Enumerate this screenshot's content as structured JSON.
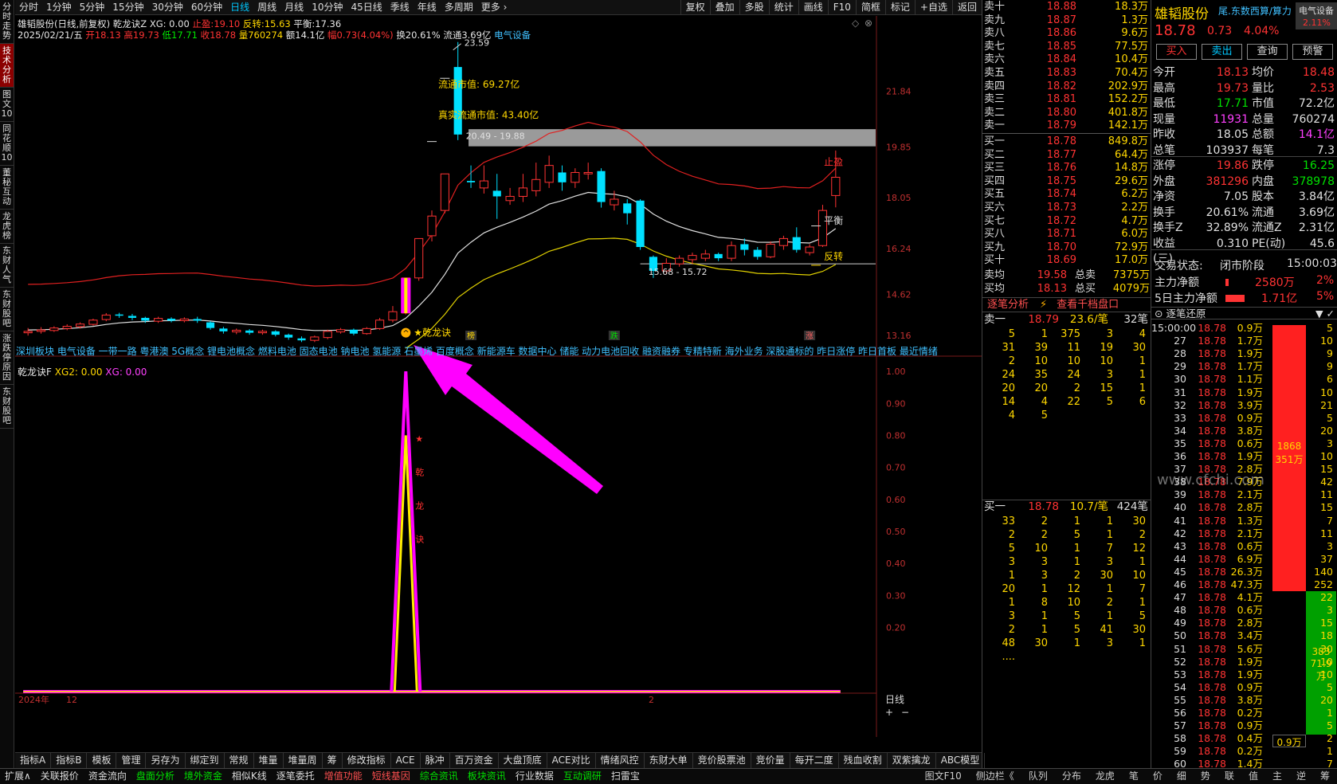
{
  "left_tabs": [
    "分时走势",
    "技术分析",
    "图文10",
    "同花顺10",
    "董秘互动",
    "龙虎榜",
    "东财人气",
    "东财股吧",
    "涨跌停原因",
    "东财股吧"
  ],
  "period_tabs": [
    "分时",
    "1分钟",
    "5分钟",
    "15分钟",
    "30分钟",
    "60分钟",
    "日线",
    "周线",
    "月线",
    "10分钟",
    "45日线",
    "季线",
    "年线",
    "多周期",
    "更多"
  ],
  "top_actions": [
    "复权",
    "叠加",
    "多股",
    "统计",
    "画线",
    "F10",
    "简框",
    "标记",
    "+自选",
    "返回"
  ],
  "info": {
    "name": "雄韬股份(日线,前复权)",
    "indicator": "乾龙诀Z",
    "xg": "XG: 0.00",
    "stop_label": "止盈:",
    "stop": "19.10",
    "reverse_label": "反转:",
    "reverse": "15.63",
    "balance_label": "平衡:",
    "balance": "17.36"
  },
  "ohlc": {
    "date": "2025/02/21/五",
    "open_l": "开",
    "open": "18.13",
    "high_l": "高",
    "high": "19.73",
    "low_l": "低",
    "low": "17.71",
    "close_l": "收",
    "close": "18.78",
    "vol_l": "量",
    "vol": "760274",
    "amt": "额14.1亿",
    "chg": "幅0.73(4.04%)",
    "turn": "换20.61%",
    "float": "流通3.69亿",
    "sector": "电气设备"
  },
  "chart_labels": {
    "peak": "23.59",
    "float_mv": "流通市值: 69.27亿",
    "real_float_mv": "真实流通市值: 43.40亿",
    "range1": "20.49 - 19.88",
    "range2": "15.68 - 15.72",
    "stop_tag": "止盈",
    "balance_tag": "平衡",
    "reverse_tag": "反转",
    "signal": "★乾龙诀",
    "marker_bang": "榜",
    "marker_die": "跌",
    "marker_zhang": "涨"
  },
  "price_axis": [
    "21.84",
    "19.85",
    "18.05",
    "16.24",
    "14.62",
    "13.16"
  ],
  "sub_axis": [
    "1.00",
    "0.90",
    "0.80",
    "0.70",
    "0.60",
    "0.50",
    "0.40",
    "0.30",
    "0.20"
  ],
  "sectors": "深圳板块 电气设备 一带一路 粤港澳 5G概念 锂电池概念 燃料电池 固态电池 钠电池 氢能源 石墨烯 百度概念 新能源车 数据中心 储能 动力电池回收 融资融券 专精特新 海外业务 深股通标的 昨日涨停 昨日首板 最近情绪",
  "sub_head": {
    "name": "乾龙诀F",
    "xg2": "XG2: 0.00",
    "xg": "XG: 0.00",
    "label": "★ 乾 龙 诀"
  },
  "x_axis": [
    "2024年",
    "12",
    "2"
  ],
  "bottom_tabs": [
    "指标A",
    "指标B",
    "模板",
    "管理",
    "另存为",
    "绑定到",
    "常规",
    "堆量",
    "堆量周",
    "筹",
    "修改指标",
    "ACE",
    "脉冲",
    "百万资金",
    "大盘顶底",
    "ACE对比",
    "情绪风控",
    "东财大单",
    "竞价股票池",
    "竞价量",
    "每开二度",
    "残血收割",
    "双紫擒龙",
    "ABC模型"
  ],
  "status_bar": [
    "扩展∧",
    "关联报价",
    "资金流向",
    "盘面分析",
    "境外资金",
    "相似K线",
    "逐笔委托",
    "增值功能",
    "短线基因",
    "综合资讯",
    "板块资讯",
    "行业数据",
    "互动调研",
    "扫雷宝"
  ],
  "status_right": [
    "图文F10",
    "侧边栏《",
    "队列",
    "分布",
    "龙虎",
    "笔",
    "价",
    "细",
    "势",
    "联",
    "值",
    "主",
    "逆",
    "筹"
  ],
  "period_right": "日线",
  "sells": [
    [
      "卖十",
      "18.88",
      "18.3万"
    ],
    [
      "卖九",
      "18.87",
      "1.3万"
    ],
    [
      "卖八",
      "18.86",
      "9.6万"
    ],
    [
      "卖七",
      "18.85",
      "77.5万"
    ],
    [
      "卖六",
      "18.84",
      "10.4万"
    ],
    [
      "卖五",
      "18.83",
      "70.4万"
    ],
    [
      "卖四",
      "18.82",
      "202.9万"
    ],
    [
      "卖三",
      "18.81",
      "152.2万"
    ],
    [
      "卖二",
      "18.80",
      "401.8万"
    ],
    [
      "卖一",
      "18.79",
      "142.1万"
    ]
  ],
  "buys": [
    [
      "买一",
      "18.78",
      "849.8万"
    ],
    [
      "买二",
      "18.77",
      "64.4万"
    ],
    [
      "买三",
      "18.76",
      "14.8万"
    ],
    [
      "买四",
      "18.75",
      "29.6万"
    ],
    [
      "买五",
      "18.74",
      "6.2万"
    ],
    [
      "买六",
      "18.73",
      "2.2万"
    ],
    [
      "买七",
      "18.72",
      "4.7万"
    ],
    [
      "买八",
      "18.71",
      "6.0万"
    ],
    [
      "买九",
      "18.70",
      "72.9万"
    ],
    [
      "买十",
      "18.69",
      "17.0万"
    ]
  ],
  "avg": [
    [
      "卖均",
      "19.58",
      "总卖",
      "7375万"
    ],
    [
      "买均",
      "18.13",
      "总买",
      "4079万"
    ]
  ],
  "tick_tabs": [
    "逐笔分析",
    "查看千档盘口"
  ],
  "sell1": {
    "label": "卖一",
    "price": "18.79",
    "per": "23.6/笔",
    "cnt": "32笔"
  },
  "sell_queue": [
    [
      "5",
      "1",
      "375",
      "3",
      "4"
    ],
    [
      "31",
      "39",
      "11",
      "19",
      "30"
    ],
    [
      "2",
      "10",
      "10",
      "10",
      "1"
    ],
    [
      "24",
      "35",
      "24",
      "3",
      "1"
    ],
    [
      "20",
      "20",
      "2",
      "15",
      "1"
    ],
    [
      "14",
      "4",
      "22",
      "5",
      "6"
    ],
    [
      "4",
      "5",
      "",
      "",
      ""
    ]
  ],
  "buy1": {
    "label": "买一",
    "price": "18.78",
    "per": "10.7/笔",
    "cnt": "424笔"
  },
  "buy_queue": [
    [
      "33",
      "2",
      "1",
      "1",
      "30"
    ],
    [
      "2",
      "2",
      "5",
      "1",
      "2"
    ],
    [
      "5",
      "10",
      "1",
      "7",
      "12"
    ],
    [
      "3",
      "3",
      "1",
      "3",
      "1"
    ],
    [
      "1",
      "3",
      "2",
      "30",
      "10"
    ],
    [
      "20",
      "1",
      "12",
      "1",
      "7"
    ],
    [
      "1",
      "8",
      "10",
      "2",
      "1"
    ],
    [
      "3",
      "1",
      "5",
      "1",
      "5"
    ],
    [
      "2",
      "1",
      "5",
      "41",
      "30"
    ],
    [
      "48",
      "30",
      "1",
      "3",
      "1"
    ],
    [
      "....",
      "",
      "",
      "",
      ""
    ]
  ],
  "quote": {
    "name": "雄韬股份",
    "tag": "尾.东数西算/算力",
    "sector_badge": "电气设备",
    "sector_pct": "2.11%",
    "price": "18.78",
    "chg": "0.73",
    "pct": "4.04%"
  },
  "quote_buttons": [
    "买入",
    "卖出",
    "查询",
    "预警"
  ],
  "quote_rows": [
    [
      "今开",
      "18.13",
      "均价",
      "18.48"
    ],
    [
      "最高",
      "19.73",
      "量比",
      "2.53"
    ],
    [
      "最低",
      "17.71",
      "市值",
      "72.2亿"
    ],
    [
      "现量",
      "11931",
      "总量",
      "760274"
    ],
    [
      "昨收",
      "18.05",
      "总额",
      "14.1亿"
    ],
    [
      "总笔",
      "103937",
      "每笔",
      "7.3"
    ],
    [
      "涨停",
      "19.86",
      "跌停",
      "16.25"
    ],
    [
      "外盘",
      "381296",
      "内盘",
      "378978"
    ],
    [
      "净资",
      "7.05",
      "股本",
      "3.84亿"
    ],
    [
      "换手",
      "20.61%",
      "流通",
      "3.69亿"
    ],
    [
      "换手Z",
      "32.89%",
      "流通Z",
      "2.31亿"
    ],
    [
      "收益(三)",
      "0.310",
      "PE(动)",
      "45.6"
    ]
  ],
  "trade_status": {
    "label": "交易状态:",
    "value": "闭市阶段",
    "time": "15:00:03"
  },
  "main_net": {
    "label": "主力净额",
    "value": "2580万",
    "pct": "2%"
  },
  "main_net5": {
    "label": "5日主力净额",
    "value": "1.71亿",
    "pct": "5%"
  },
  "trade_title": "逐笔还原",
  "trades": [
    [
      "15:00:00",
      "18.78",
      "0.9万",
      "5"
    ],
    [
      "27",
      "18.78",
      "1.7万",
      "10"
    ],
    [
      "28",
      "18.78",
      "1.9万",
      "9"
    ],
    [
      "29",
      "18.78",
      "1.7万",
      "9"
    ],
    [
      "30",
      "18.78",
      "1.1万",
      "6"
    ],
    [
      "31",
      "18.78",
      "1.9万",
      "10"
    ],
    [
      "32",
      "18.78",
      "3.9万",
      "21"
    ],
    [
      "33",
      "18.78",
      "0.9万",
      "5"
    ],
    [
      "34",
      "18.78",
      "3.8万",
      "20"
    ],
    [
      "35",
      "18.78",
      "0.6万",
      "3"
    ],
    [
      "36",
      "18.78",
      "1.9万",
      "10"
    ],
    [
      "37",
      "18.78",
      "2.8万",
      "15"
    ],
    [
      "38",
      "18.78",
      "7.9万",
      "42"
    ],
    [
      "39",
      "18.78",
      "2.1万",
      "11"
    ],
    [
      "40",
      "18.78",
      "2.8万",
      "15"
    ],
    [
      "41",
      "18.78",
      "1.3万",
      "7"
    ],
    [
      "42",
      "18.78",
      "2.1万",
      "11"
    ],
    [
      "43",
      "18.78",
      "0.6万",
      "3"
    ],
    [
      "44",
      "18.78",
      "6.9万",
      "37"
    ],
    [
      "45",
      "18.78",
      "26.3万",
      "140"
    ],
    [
      "46",
      "18.78",
      "47.3万",
      "252"
    ],
    [
      "47",
      "18.78",
      "4.1万",
      "22"
    ],
    [
      "48",
      "18.78",
      "0.6万",
      "3"
    ],
    [
      "49",
      "18.78",
      "2.8万",
      "15"
    ],
    [
      "50",
      "18.78",
      "3.4万",
      "18"
    ],
    [
      "51",
      "18.78",
      "5.6万",
      "30"
    ],
    [
      "52",
      "18.78",
      "1.9万",
      "10"
    ],
    [
      "53",
      "18.78",
      "1.9万",
      "10"
    ],
    [
      "54",
      "18.78",
      "0.9万",
      "5"
    ],
    [
      "55",
      "18.78",
      "3.8万",
      "20"
    ],
    [
      "56",
      "18.78",
      "0.2万",
      "1"
    ],
    [
      "57",
      "18.78",
      "0.9万",
      "5"
    ],
    [
      "58",
      "18.78",
      "0.4万",
      "2"
    ],
    [
      "59",
      "18.78",
      "0.2万",
      "1"
    ],
    [
      "60",
      "18.78",
      "1.4万",
      "7"
    ]
  ],
  "bar1": {
    "n": "1868",
    "v": "351万"
  },
  "bar2": {
    "n": "383",
    "v": "71.9万"
  },
  "bar3": {
    "v": "0.9万"
  },
  "watermark": "www.cfchi.com",
  "colors": {
    "up": "#ff3333",
    "down": "#00e0ff",
    "ma_red": "#e02020",
    "ma_white": "#e0e0e0",
    "ma_yellow": "#e0d000",
    "signal": "#ff00ff"
  },
  "candles": [
    {
      "o": 13.25,
      "c": 13.3,
      "h": 13.42,
      "l": 13.15
    },
    {
      "o": 13.3,
      "c": 13.35,
      "h": 13.45,
      "l": 13.22
    },
    {
      "o": 13.33,
      "c": 13.42,
      "h": 13.48,
      "l": 13.28
    },
    {
      "o": 13.4,
      "c": 13.48,
      "h": 13.55,
      "l": 13.34
    },
    {
      "o": 13.47,
      "c": 13.56,
      "h": 13.62,
      "l": 13.4
    },
    {
      "o": 13.55,
      "c": 13.7,
      "h": 13.75,
      "l": 13.5
    },
    {
      "o": 13.72,
      "c": 13.88,
      "h": 13.95,
      "l": 13.66
    },
    {
      "o": 13.9,
      "c": 13.86,
      "h": 13.96,
      "l": 13.78
    },
    {
      "o": 13.85,
      "c": 13.78,
      "h": 13.92,
      "l": 13.7
    },
    {
      "o": 13.78,
      "c": 13.68,
      "h": 13.82,
      "l": 13.6
    },
    {
      "o": 13.66,
      "c": 13.76,
      "h": 13.82,
      "l": 13.6
    },
    {
      "o": 13.75,
      "c": 13.68,
      "h": 13.8,
      "l": 13.62
    },
    {
      "o": 13.68,
      "c": 13.74,
      "h": 13.8,
      "l": 13.62
    },
    {
      "o": 13.74,
      "c": 13.68,
      "h": 13.82,
      "l": 13.6
    },
    {
      "o": 13.62,
      "c": 13.42,
      "h": 13.66,
      "l": 13.36
    },
    {
      "o": 13.4,
      "c": 13.3,
      "h": 13.46,
      "l": 13.22
    },
    {
      "o": 13.28,
      "c": 13.34,
      "h": 13.4,
      "l": 13.2
    },
    {
      "o": 13.33,
      "c": 13.25,
      "h": 13.38,
      "l": 13.18
    },
    {
      "o": 13.25,
      "c": 13.3,
      "h": 13.36,
      "l": 13.18
    },
    {
      "o": 13.3,
      "c": 13.18,
      "h": 13.34,
      "l": 13.12
    },
    {
      "o": 13.18,
      "c": 13.08,
      "h": 13.22,
      "l": 13.0
    },
    {
      "o": 13.05,
      "c": 12.98,
      "h": 13.12,
      "l": 12.92
    },
    {
      "o": 12.98,
      "c": 13.1,
      "h": 13.15,
      "l": 12.92
    },
    {
      "o": 13.08,
      "c": 13.3,
      "h": 13.36,
      "l": 13.02
    },
    {
      "o": 13.28,
      "c": 13.36,
      "h": 13.42,
      "l": 13.22
    },
    {
      "o": 13.36,
      "c": 13.22,
      "h": 13.4,
      "l": 13.16
    },
    {
      "o": 13.22,
      "c": 13.4,
      "h": 13.45,
      "l": 13.18
    },
    {
      "o": 13.4,
      "c": 13.7,
      "h": 13.78,
      "l": 13.35
    },
    {
      "o": 13.7,
      "c": 14.0,
      "h": 14.2,
      "l": 13.62
    },
    {
      "o": 13.95,
      "c": 15.2,
      "h": 15.2,
      "l": 13.9
    },
    {
      "o": 15.2,
      "c": 16.6,
      "h": 16.6,
      "l": 15.1
    },
    {
      "o": 16.7,
      "c": 17.4,
      "h": 17.6,
      "l": 16.5
    },
    {
      "o": 17.6,
      "c": 18.9,
      "h": 18.9,
      "l": 17.5
    },
    {
      "o": 22.7,
      "c": 20.3,
      "h": 23.59,
      "l": 20.1
    },
    {
      "o": 18.65,
      "c": 18.6,
      "h": 19.2,
      "l": 18.4
    },
    {
      "o": 18.4,
      "c": 18.65,
      "h": 19.2,
      "l": 18.2
    },
    {
      "o": 18.3,
      "c": 18.1,
      "h": 18.9,
      "l": 17.3
    },
    {
      "o": 17.95,
      "c": 18.1,
      "h": 18.4,
      "l": 17.8
    },
    {
      "o": 18.1,
      "c": 18.4,
      "h": 18.9,
      "l": 17.9
    },
    {
      "o": 18.3,
      "c": 18.7,
      "h": 19.3,
      "l": 18.1
    },
    {
      "o": 18.6,
      "c": 19.2,
      "h": 19.55,
      "l": 18.4
    },
    {
      "o": 18.95,
      "c": 18.6,
      "h": 19.2,
      "l": 18.3
    },
    {
      "o": 18.6,
      "c": 18.95,
      "h": 19.1,
      "l": 18.4
    },
    {
      "o": 18.9,
      "c": 18.95,
      "h": 19.3,
      "l": 18.7
    },
    {
      "o": 19.0,
      "c": 17.9,
      "h": 19.1,
      "l": 17.7
    },
    {
      "o": 17.8,
      "c": 18.0,
      "h": 18.3,
      "l": 17.6
    },
    {
      "o": 17.85,
      "c": 17.5,
      "h": 18.0,
      "l": 17.1
    },
    {
      "o": 17.95,
      "c": 16.3,
      "h": 18.0,
      "l": 16.2
    },
    {
      "o": 15.95,
      "c": 15.45,
      "h": 16.0,
      "l": 15.2
    },
    {
      "o": 15.45,
      "c": 15.72,
      "h": 15.9,
      "l": 15.35
    },
    {
      "o": 15.7,
      "c": 15.9,
      "h": 16.0,
      "l": 15.6
    },
    {
      "o": 15.85,
      "c": 16.0,
      "h": 16.1,
      "l": 15.7
    },
    {
      "o": 15.9,
      "c": 16.05,
      "h": 16.2,
      "l": 15.8
    },
    {
      "o": 16.05,
      "c": 15.9,
      "h": 16.1,
      "l": 15.8
    },
    {
      "o": 15.9,
      "c": 16.35,
      "h": 16.5,
      "l": 15.8
    },
    {
      "o": 16.4,
      "c": 16.2,
      "h": 16.6,
      "l": 16.0
    },
    {
      "o": 16.2,
      "c": 15.95,
      "h": 16.3,
      "l": 15.85
    },
    {
      "o": 15.95,
      "c": 16.4,
      "h": 16.5,
      "l": 15.9
    },
    {
      "o": 16.35,
      "c": 16.6,
      "h": 16.7,
      "l": 16.2
    },
    {
      "o": 16.65,
      "c": 16.2,
      "h": 17.0,
      "l": 16.1
    },
    {
      "o": 16.1,
      "c": 16.3,
      "h": 16.4,
      "l": 16.0
    },
    {
      "o": 16.35,
      "c": 17.6,
      "h": 17.8,
      "l": 16.3
    },
    {
      "o": 18.13,
      "c": 18.78,
      "h": 19.73,
      "l": 17.71
    }
  ]
}
